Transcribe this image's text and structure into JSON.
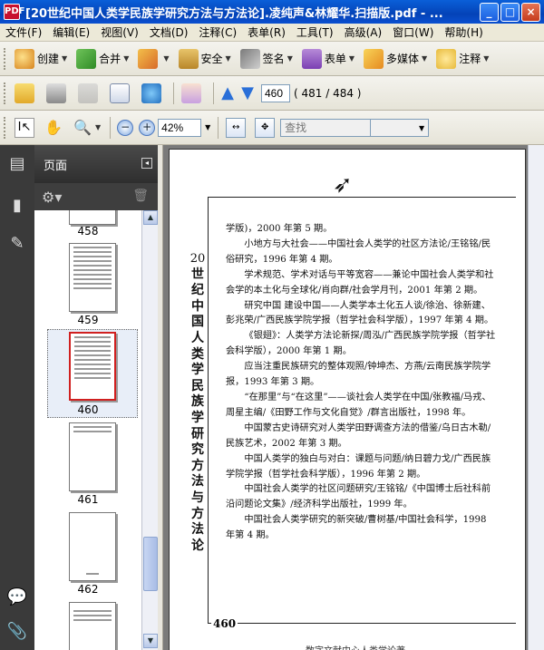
{
  "window": {
    "title": "[20世纪中国人类学民族学研究方法与方法论].凌纯声&林耀华.扫描版.pdf - ...",
    "app_icon": "PDF"
  },
  "menu": [
    "文件(F)",
    "编辑(E)",
    "视图(V)",
    "文档(D)",
    "注释(C)",
    "表单(R)",
    "工具(T)",
    "高级(A)",
    "窗口(W)",
    "帮助(H)"
  ],
  "toolbar1": {
    "create": "创建",
    "merge": "合并",
    "secure": "安全",
    "sign": "签名",
    "forms": "表单",
    "multimedia": "多媒体",
    "comment": "注释"
  },
  "nav": {
    "current_page": "460",
    "page_count": "( 481 / 484 )"
  },
  "zoom": {
    "value": "42%"
  },
  "search": {
    "placeholder": "查找"
  },
  "panel": {
    "title": "页面",
    "thumbnails": [
      {
        "label": "458"
      },
      {
        "label": "459"
      },
      {
        "label": "460"
      },
      {
        "label": "461"
      },
      {
        "label": "462"
      }
    ]
  },
  "document": {
    "vertical_title_num": "20",
    "vertical_title": [
      "世",
      "纪",
      "中",
      "国",
      "人",
      "类",
      "学",
      "民",
      "族",
      "学",
      "研",
      "究",
      "方",
      "法",
      "与",
      "方",
      "法",
      "论"
    ],
    "paragraphs": [
      {
        "indent": false,
        "text": "学版)，2000 年第 5 期。"
      },
      {
        "indent": true,
        "text": "小地方与大社会——中国社会人类学的社区方法论/王铭铭/民俗研究，1996 年第 4 期。"
      },
      {
        "indent": true,
        "text": "学术规范、学术对话与平等宽容——兼论中国社会人类学和社会学的本土化与全球化/肖向群/社会学月刊，2001 年第 2 期。"
      },
      {
        "indent": true,
        "text": "研究中国 建设中国——人类学本土化五人谈/徐治、徐新建、彭兆荣/广西民族学院学报（哲学社会科学版），1997 年第 4 期。"
      },
      {
        "indent": true,
        "text": "《银翅》：人类学方法论新探/周泓/广西民族学院学报（哲学社会科学版），2000 年第 1 期。"
      },
      {
        "indent": true,
        "text": "应当注重民族研究的整体观照/钟坤杰、方燕/云南民族学院学报，1993 年第 3 期。"
      },
      {
        "indent": true,
        "text": "“在那里”与“在这里”——谈社会人类学在中国/张教福/马戎、周星主编/《田野工作与文化自觉》/群言出版社，1998 年。"
      },
      {
        "indent": true,
        "text": "中国蒙古史诗研究对人类学田野调查方法的借鉴/乌日古木勒/民族艺术，2002 年第 3 期。"
      },
      {
        "indent": true,
        "text": "中国人类学的独白与对白：课题与问题/纳日碧力戈/广西民族学院学报（哲学社会科学版），1996 年第 2 期。"
      },
      {
        "indent": true,
        "text": "中国社会人类学的社区问题研究/王铭铭/《中国博士后社科前沿问题论文集》/经济科学出版社，1999 年。"
      },
      {
        "indent": true,
        "text": "中国社会人类学研究的新突破/曹树基/中国社会科学，1998 年第 4 期。"
      }
    ],
    "page_number": "460",
    "footer": "数字文献中心人类学论著"
  }
}
